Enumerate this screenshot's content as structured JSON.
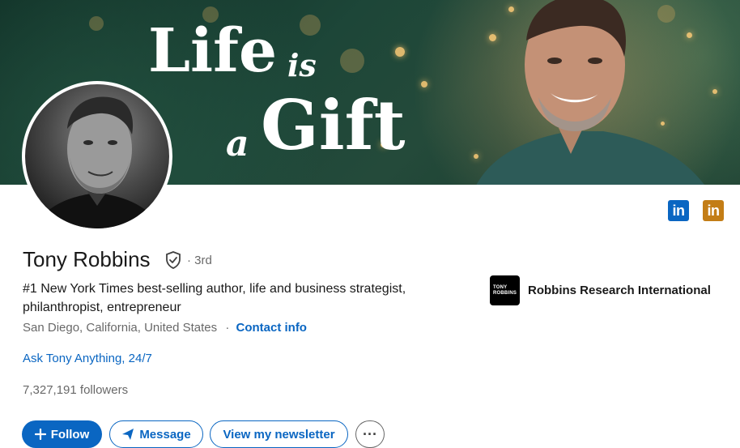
{
  "banner": {
    "title_word1": "Life",
    "title_word2": "is",
    "title_word3": "a",
    "title_word4": "Gift"
  },
  "profile": {
    "name": "Tony Robbins",
    "degree": "· 3rd",
    "headline": "#1 New York Times best-selling author, life and business strategist, philanthropist, entrepreneur",
    "location": "San Diego, California, United States",
    "location_separator": "·",
    "contact_label": "Contact info",
    "website_label": "Ask Tony Anything, 24/7",
    "followers": "7,327,191 followers"
  },
  "company": {
    "logo_line1": "TONY",
    "logo_line2": "ROBBINS",
    "name": "Robbins Research International"
  },
  "badges": {
    "linkedin_label_1": "in",
    "linkedin_label_2": "in"
  },
  "actions": {
    "follow_label": "Follow",
    "message_label": "Message",
    "newsletter_label": "View my newsletter",
    "more_label": "···"
  },
  "colors": {
    "primary_blue": "#0a66c2",
    "badge_orange": "#c37d16"
  },
  "icons": [
    "plus-icon",
    "send-icon",
    "verified-shield-icon",
    "more-icon",
    "linkedin-icon"
  ]
}
